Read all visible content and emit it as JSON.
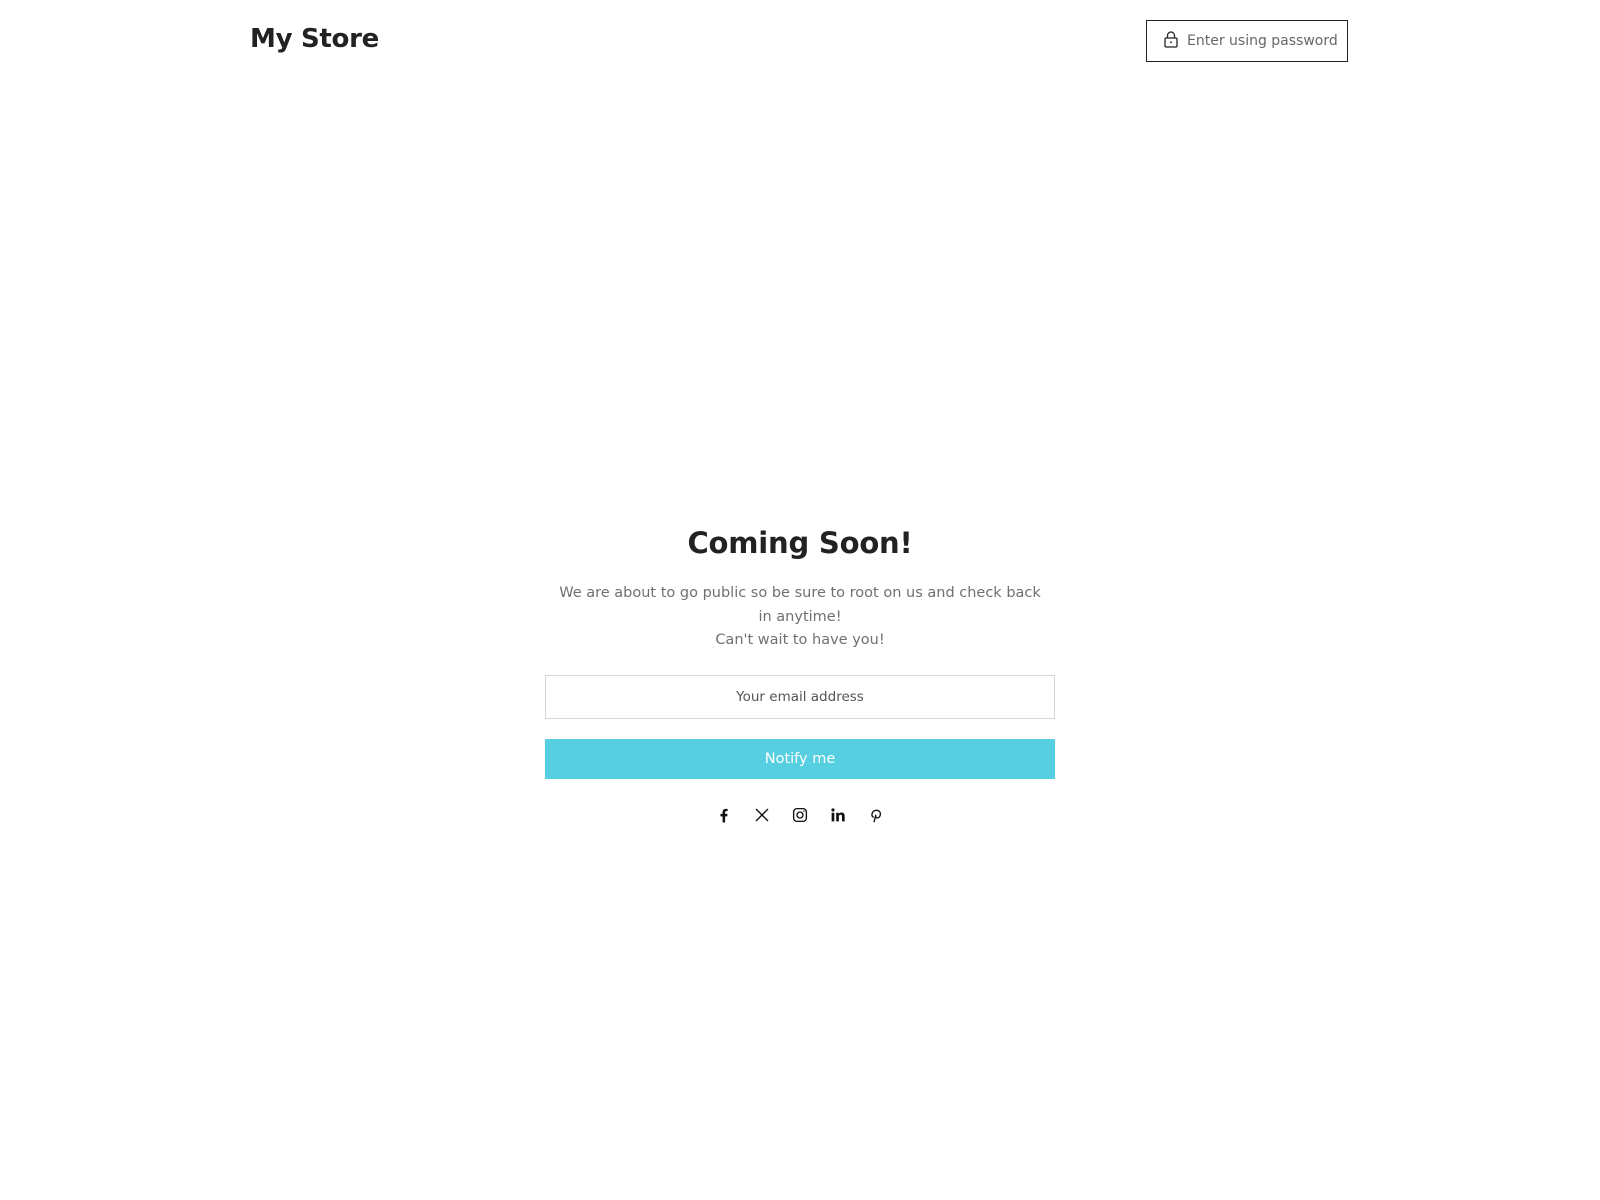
{
  "header": {
    "brand": "My Store",
    "password_button": "Enter using password",
    "password_icon": "lock-icon"
  },
  "main": {
    "title": "Coming Soon!",
    "description_line1": "We are about to go public so be sure to root on us and check back in anytime!",
    "description_line2": "Can't wait to have you!",
    "email_placeholder": "Your email address",
    "email_value": "",
    "notify_button": "Notify me"
  },
  "social": {
    "icons": [
      "facebook-icon",
      "x-icon",
      "instagram-icon",
      "linkedin-icon",
      "pinterest-icon"
    ]
  },
  "colors": {
    "accent": "#56cfe1",
    "text": "#222222",
    "muted_text": "#707070",
    "border": "#222222"
  }
}
